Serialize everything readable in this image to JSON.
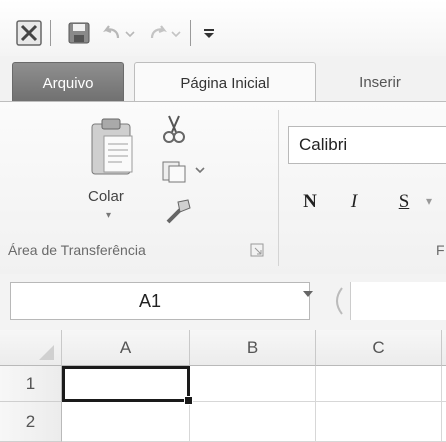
{
  "quick_access": {
    "items": [
      {
        "name": "excel-icon"
      },
      {
        "name": "save-icon"
      },
      {
        "name": "undo-icon"
      },
      {
        "name": "redo-icon"
      },
      {
        "name": "customize-icon"
      }
    ]
  },
  "tabs": [
    {
      "label": "Arquivo",
      "active": false
    },
    {
      "label": "Página Inicial",
      "active": true
    },
    {
      "label": "Inserir",
      "active": false
    }
  ],
  "ribbon": {
    "clipboard": {
      "paste_label": "Colar",
      "group_label": "Área de Transferência",
      "icons": [
        "paste-icon",
        "cut-icon",
        "copy-icon",
        "format-painter-icon"
      ]
    },
    "font": {
      "font_name": "Calibri",
      "bold_label": "N",
      "italic_label": "I",
      "underline_label": "S",
      "group_label_fragment": "F"
    }
  },
  "formula_bar": {
    "name_box_value": "A1"
  },
  "grid": {
    "columns": [
      "A",
      "B",
      "C"
    ],
    "rows": [
      "1",
      "2"
    ],
    "selected_cell": "A1"
  },
  "colors": {
    "file_tab": "#7a7a7a",
    "selection_border": "#1a1a1a"
  }
}
